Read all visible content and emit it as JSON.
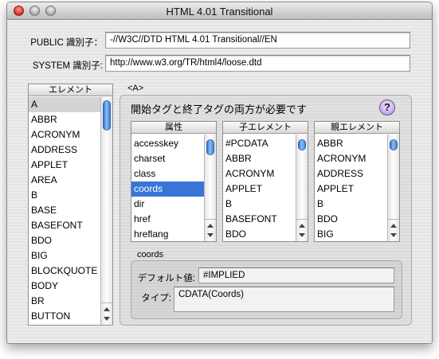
{
  "window": {
    "title": "HTML 4.01 Transitional"
  },
  "doctype": {
    "public_label": "PUBLIC 識別子：",
    "public_value": "-//W3C//DTD HTML 4.01 Transitional//EN",
    "system_label": "SYSTEM 識別子:",
    "system_value": "http://www.w3.org/TR/html4/loose.dtd"
  },
  "elements": {
    "header": "エレメント",
    "items": [
      "A",
      "ABBR",
      "ACRONYM",
      "ADDRESS",
      "APPLET",
      "AREA",
      "B",
      "BASE",
      "BASEFONT",
      "BDO",
      "BIG",
      "BLOCKQUOTE",
      "BODY",
      "BR",
      "BUTTON"
    ],
    "selected": "A"
  },
  "detail": {
    "title": "<A>",
    "description": "開始タグと終了タグの両方が必要です",
    "help_label": "?",
    "attributes": {
      "header": "属性",
      "items": [
        "accesskey",
        "charset",
        "class",
        "coords",
        "dir",
        "href",
        "hreflang"
      ],
      "selected": "coords"
    },
    "children": {
      "header": "子エレメント",
      "items": [
        "#PCDATA",
        "ABBR",
        "ACRONYM",
        "APPLET",
        "B",
        "BASEFONT",
        "BDO"
      ]
    },
    "parents": {
      "header": "親エレメント",
      "items": [
        "ABBR",
        "ACRONYM",
        "ADDRESS",
        "APPLET",
        "B",
        "BDO",
        "BIG"
      ]
    },
    "attribute_info": {
      "title": "coords",
      "default_label": "デフォルト値:",
      "default_value": "#IMPLIED",
      "type_label": "タイプ:",
      "type_value": "CDATA(Coords)"
    }
  },
  "colors": {
    "selection": "#3875d7",
    "selection_inactive": "#d4d4d4"
  }
}
